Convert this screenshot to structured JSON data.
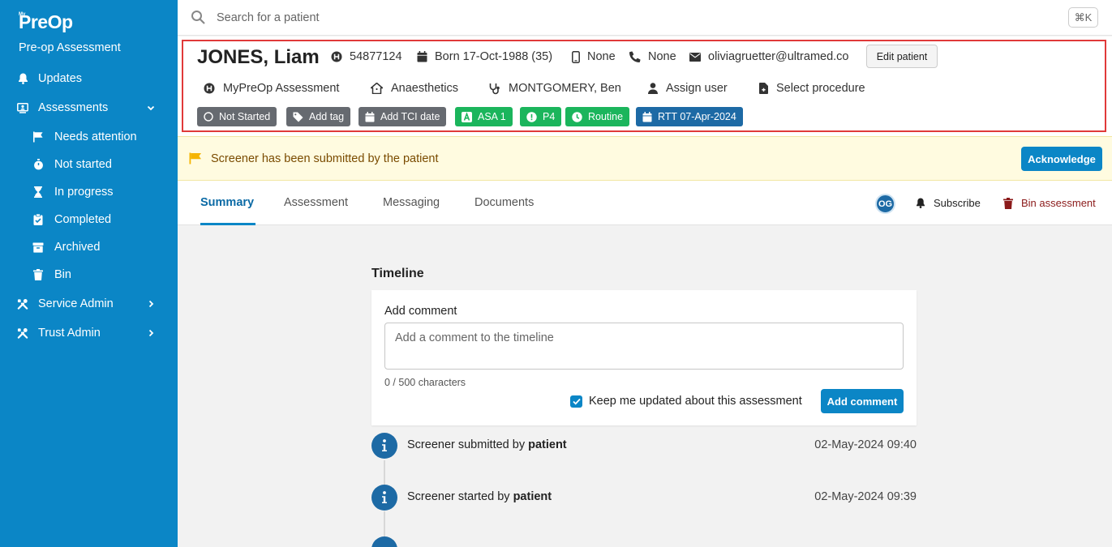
{
  "sidebar": {
    "logo": "PreOp",
    "logo_sup": "My",
    "app_name": "Pre-op Assessment",
    "items": [
      {
        "label": "Updates"
      },
      {
        "label": "Assessments"
      },
      {
        "label": "Needs attention"
      },
      {
        "label": "Not started"
      },
      {
        "label": "In progress"
      },
      {
        "label": "Completed"
      },
      {
        "label": "Archived"
      },
      {
        "label": "Bin"
      },
      {
        "label": "Service Admin"
      },
      {
        "label": "Trust Admin"
      }
    ]
  },
  "search": {
    "placeholder": "Search for a patient",
    "shortcut": "⌘K"
  },
  "patient": {
    "name": "JONES, Liam",
    "hospital_number": "54877124",
    "born": "Born 17-Oct-1988 (35)",
    "mobile": "None",
    "phone": "None",
    "email": "oliviagruetter@ultramed.co",
    "edit_label": "Edit patient",
    "assessment_type": "MyPreOp Assessment",
    "department": "Anaesthetics",
    "clinician": "MONTGOMERY, Ben",
    "assign_user": "Assign user",
    "select_procedure": "Select procedure",
    "tags": {
      "status": "Not Started",
      "add_tag": "Add tag",
      "add_tci": "Add TCI date",
      "asa": "ASA 1",
      "priority": "P4",
      "routine": "Routine",
      "rtt": "RTT 07-Apr-2024"
    }
  },
  "notice": {
    "message": "Screener has been submitted by the patient",
    "action": "Acknowledge"
  },
  "tabs": {
    "items": [
      {
        "label": "Summary"
      },
      {
        "label": "Assessment"
      },
      {
        "label": "Messaging"
      },
      {
        "label": "Documents"
      }
    ],
    "avatar": "OG",
    "subscribe": "Subscribe",
    "bin": "Bin assessment"
  },
  "timeline": {
    "title": "Timeline",
    "add_comment_label": "Add comment",
    "placeholder": "Add a comment to the timeline",
    "char_count": "0 / 500 characters",
    "keep_updated": "Keep me updated about this assessment",
    "submit_label": "Add comment",
    "events": [
      {
        "text": "Screener submitted by ",
        "actor": "patient",
        "date": "02-May-2024 09:40"
      },
      {
        "text": "Screener started by ",
        "actor": "patient",
        "date": "02-May-2024 09:39"
      }
    ]
  },
  "colors": {
    "primary": "#0b86c6",
    "tag_green": "#1bb55c",
    "tag_blue": "#1d6aa5",
    "tag_grey": "#666a70",
    "danger": "#8b1a1a",
    "highlight_frame": "#e03a3a"
  }
}
